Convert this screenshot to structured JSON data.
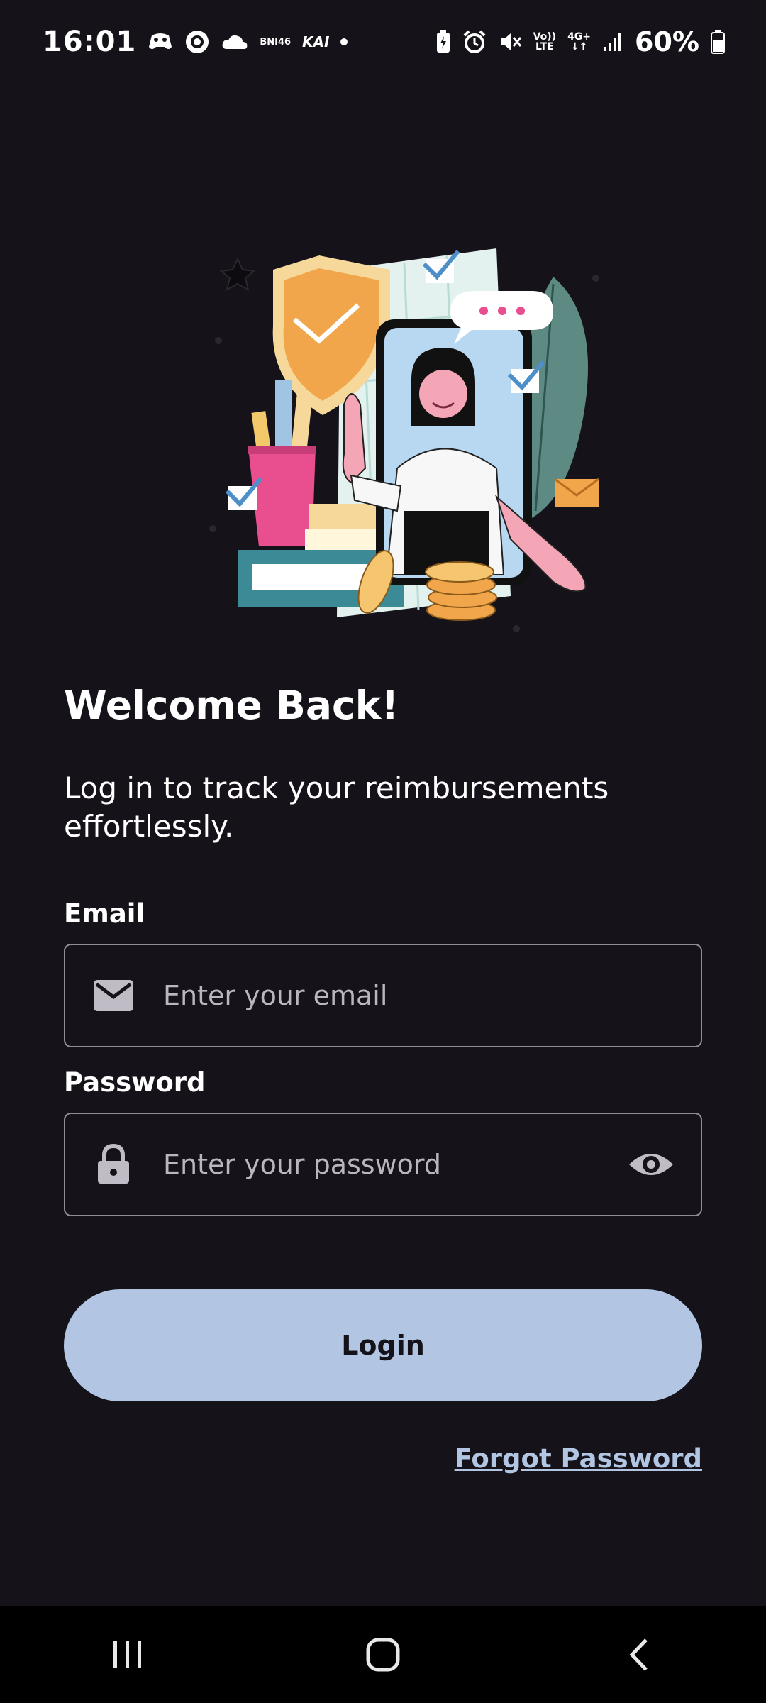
{
  "status_bar": {
    "time": "16:01",
    "notif_icons": [
      "game-controller-icon",
      "target-app-icon",
      "cloud-icon"
    ],
    "bni_label": "BNI46",
    "kai_label": "KAI",
    "network_label_top": "Vo))",
    "network_label_bottom": "LTE",
    "data_label": "4G+",
    "battery_percent": "60%"
  },
  "welcome": {
    "title": "Welcome Back!",
    "subtitle": "Log in to track your reimbursements effortlessly."
  },
  "email": {
    "label": "Email",
    "placeholder": "Enter your email",
    "icon": "mail-icon"
  },
  "password": {
    "label": "Password",
    "placeholder": "Enter your password",
    "icon": "lock-icon",
    "toggle_icon": "eye-icon"
  },
  "actions": {
    "login_label": "Login",
    "forgot_label": "Forgot Password"
  },
  "colors": {
    "background": "#15121a",
    "primary_button": "#b2c6e3",
    "link": "#b2c6e3",
    "input_border": "#8f8c96"
  }
}
